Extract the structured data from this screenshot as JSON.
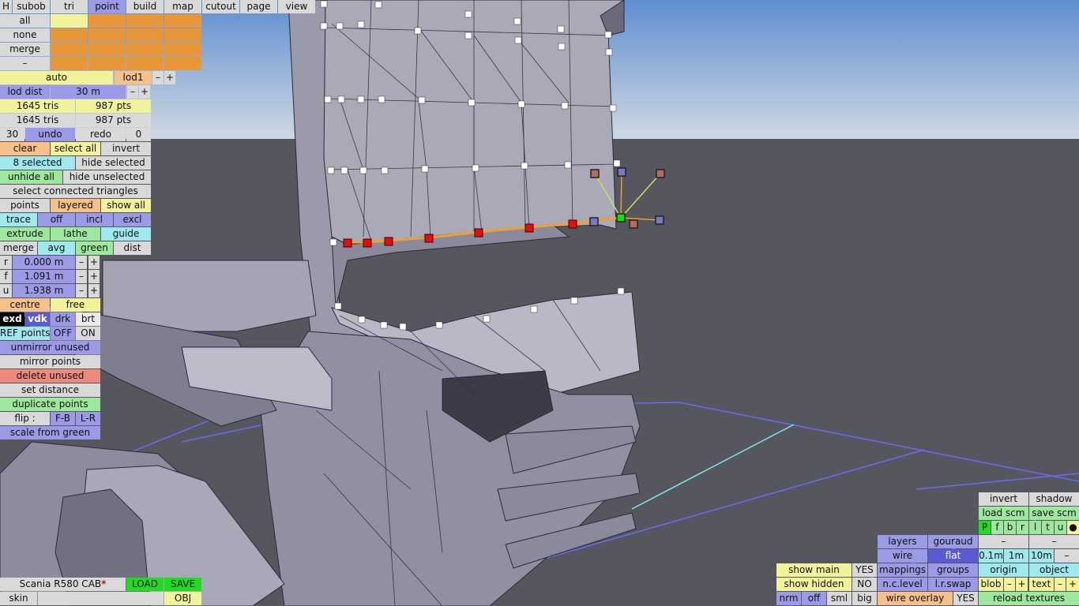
{
  "tabs": [
    "H",
    "subob",
    "tri",
    "point",
    "build",
    "map",
    "cutout",
    "page",
    "view"
  ],
  "palette_rows": [
    "all",
    "none",
    "merge",
    "–"
  ],
  "lod": {
    "auto": "auto",
    "lod1": "lod1",
    "minus": "–",
    "plus": "+",
    "dist_label": "lod dist",
    "dist_value": "30 m"
  },
  "stats": {
    "tris1": "1645 tris",
    "pts1": "987 pts",
    "tris2": "1645 tris",
    "pts2": "987 pts"
  },
  "undo_row": {
    "count": "30",
    "undo": "undo",
    "redo": "redo",
    "redo_count": "0"
  },
  "sel": {
    "clear": "clear",
    "select_all": "select all",
    "invert": "invert",
    "selected": "8 selected",
    "hide_selected": "hide selected",
    "unhide_all": "unhide all",
    "hide_unselected": "hide unselected",
    "connected": "select connected triangles"
  },
  "mode": {
    "points": "points",
    "layered": "layered",
    "show_all": "show all"
  },
  "trace": {
    "trace": "trace",
    "off": "off",
    "incl": "incl",
    "excl": "excl"
  },
  "ops": {
    "extrude": "extrude",
    "lathe": "lathe",
    "guide": "guide",
    "merge": "merge",
    "avg": "avg",
    "green": "green",
    "dist": "dist"
  },
  "coords": {
    "r_label": "r",
    "r_value": "0.000 m",
    "f_label": "f",
    "f_value": "1.091 m",
    "u_label": "u",
    "u_value": "1.938 m"
  },
  "pivot": {
    "centre": "centre",
    "free": "free"
  },
  "shade": {
    "exd": "exd",
    "vdk": "vdk",
    "drk": "drk",
    "brt": "brt"
  },
  "ref": {
    "label": "REF points",
    "off": "OFF",
    "on": "ON"
  },
  "tools": {
    "unmirror": "unmirror unused",
    "mirror": "mirror points",
    "delete": "delete unused",
    "set_distance": "set distance",
    "duplicate": "duplicate points",
    "flip": "flip :",
    "fb": "F-B",
    "lr": "L-R",
    "scale": "scale from green"
  },
  "file": {
    "name": "Scania R580 CAB",
    "dirty_mark": "*",
    "load": "LOAD",
    "save": "SAVE",
    "skin": "skin",
    "obj": "OBJ"
  },
  "view_panel": {
    "show_main": "show main",
    "show_main_val": "YES",
    "show_hidden": "show hidden",
    "show_hidden_val": "NO",
    "nrm": "nrm",
    "off": "off",
    "sml": "sml",
    "big": "big",
    "layers": "layers",
    "gouraud": "gouraud",
    "wire": "wire",
    "flat": "flat",
    "mappings": "mappings",
    "groups": "groups",
    "nc_level": "n.c.level",
    "lr_swap": "l.r.swap",
    "wire_overlay": "wire overlay",
    "wire_overlay_val": "YES"
  },
  "right_panel": {
    "invert": "invert",
    "shadow": "shadow",
    "load_scm": "load scm",
    "save_scm": "save scm",
    "views": [
      "P",
      "f",
      "b",
      "r",
      "l",
      "t",
      "u",
      "●"
    ],
    "dash1": "–",
    "dash2": "–",
    "s01": "0.1m",
    "s1": "1m",
    "s10": "10m",
    "sminus": "–",
    "origin": "origin",
    "object": "object",
    "blob": "blob",
    "minus": "–",
    "plus": "+",
    "text": "text",
    "reload": "reload textures"
  },
  "colors": {
    "sky": "#8ab0d6",
    "floor": "#5a5a62",
    "grid": "#6a6af0",
    "mesh": "#8c8ca0"
  }
}
